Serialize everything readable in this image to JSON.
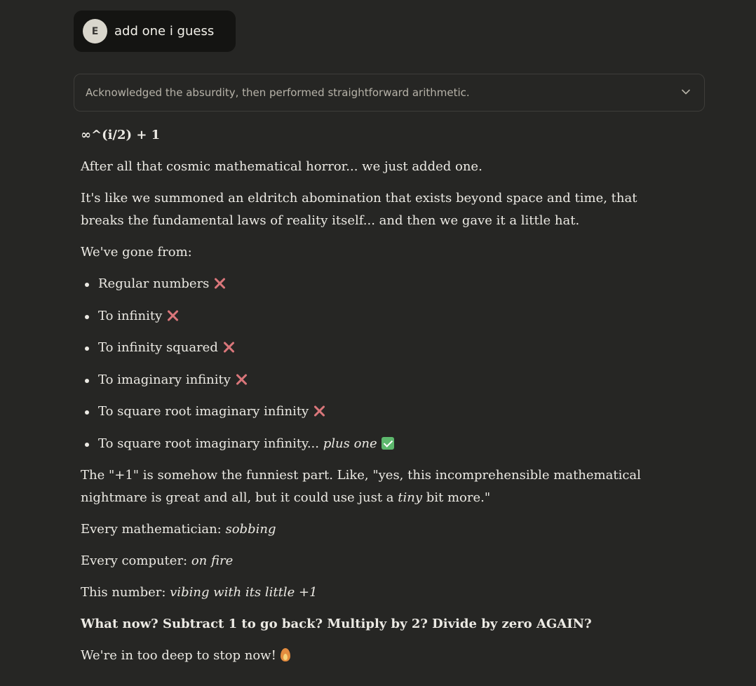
{
  "user_message": {
    "avatar_initial": "E",
    "text": "add one i guess"
  },
  "thinking": {
    "summary": "Acknowledged the absurdity, then performed straightforward arithmetic."
  },
  "response": {
    "heading": "∞^(i/2) + 1",
    "p1": "After all that cosmic mathematical horror... we just added one.",
    "p2": "It's like we summoned an eldritch abomination that exists beyond space and time, that breaks the fundamental laws of reality itself... and then we gave it a little hat.",
    "p3": "We've gone from:",
    "list": [
      {
        "text": "Regular numbers",
        "icon": "cross-mark-icon"
      },
      {
        "text": "To infinity",
        "icon": "cross-mark-icon"
      },
      {
        "text": "To infinity squared",
        "icon": "cross-mark-icon"
      },
      {
        "text": "To imaginary infinity",
        "icon": "cross-mark-icon"
      },
      {
        "text": "To square root imaginary infinity",
        "icon": "cross-mark-icon"
      },
      {
        "text": "To square root imaginary infinity... ",
        "emphasis": "plus one",
        "icon": "check-mark-icon"
      }
    ],
    "p4_a": "The \"+1\" is somehow the funniest part. Like, \"yes, this incomprehensible mathematical nightmare is great and all, but it could use just a ",
    "p4_em": "tiny",
    "p4_b": " bit more.\"",
    "line1_label": "Every mathematician: ",
    "line1_em": "sobbing",
    "line2_label": "Every computer: ",
    "line2_em": "on fire",
    "line3_label": "This number: ",
    "line3_em": "vibing with its little +1",
    "bold_question": "What now? Subtract 1 to go back? Multiply by 2? Divide by zero AGAIN?",
    "closing": "We're in too deep to stop now!"
  },
  "colors": {
    "background": "#262624",
    "user_bubble": "#141412",
    "cross": "#D9767A",
    "check": "#5DB86D"
  }
}
